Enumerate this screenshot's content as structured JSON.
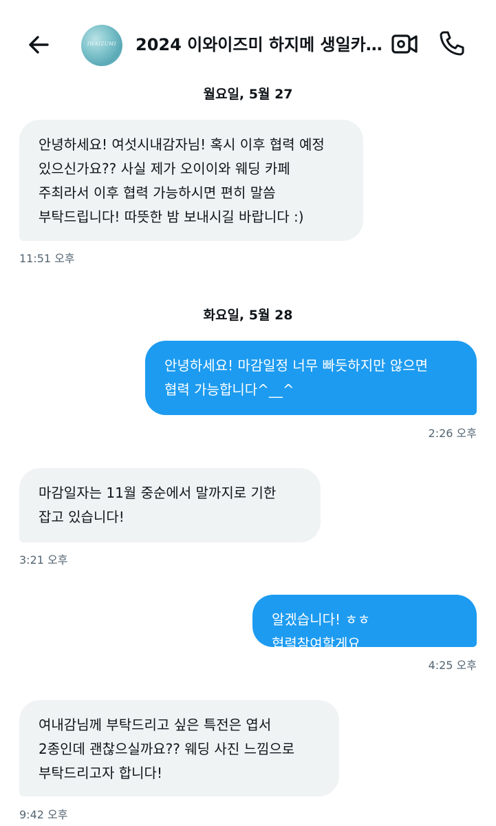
{
  "header": {
    "title": "2024 이와이즈미 하지메 생일카...",
    "avatar_text": "IWAIZUMI",
    "back_icon": "arrow-left-icon",
    "video_icon": "video-camera-icon",
    "call_icon": "phone-icon"
  },
  "messages": {
    "day1": {
      "label": "월요일, 5월 27"
    },
    "m1": {
      "text": "안녕하세요! 여섯시내감자님! 혹시 이후 협력 예정 있으신가요?? 사실 제가 오이이와 웨딩 카페 주최라서 이후 협력 가능하시면 편히 말씀 부탁드립니다! 따뜻한 밤 보내시길 바랍니다 :)",
      "time": "11:51 오후"
    },
    "day2": {
      "label": "화요일, 5월 28"
    },
    "m2": {
      "text": "안녕하세요! 마감일정 너무 빠듯하지만 않으면 협력 가능합니다^__^",
      "time": "2:26 오후"
    },
    "m3": {
      "text": "마감일자는 11월 중순에서 말까지로 기한 잡고 있습니다!",
      "time": "3:21 오후"
    },
    "m4": {
      "text": "알겠습니다! ㅎㅎ 협력참여할게요",
      "time": "4:25 오후"
    },
    "m5": {
      "text": "여내감님께 부탁드리고 싶은 특전은 엽서 2종인데 괜찮으실까요?? 웨딩 사진 느낌으로 부탁드리고자 합니다!",
      "time": "9:42 오후"
    }
  },
  "colors": {
    "sent_bubble": "#1d9bf0",
    "received_bubble": "#eff3f4",
    "timestamp": "#536471",
    "text": "#0f1419"
  }
}
